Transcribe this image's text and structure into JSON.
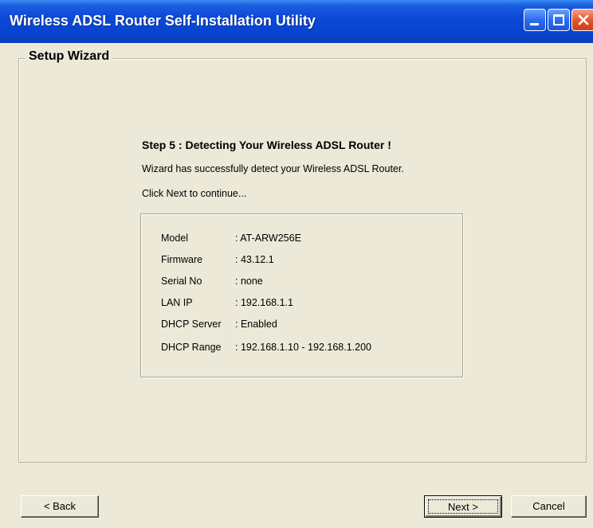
{
  "window": {
    "title": "Wireless ADSL Router Self-Installation Utility",
    "controls": [
      "minimize",
      "maximize",
      "close"
    ]
  },
  "wizard": {
    "group_title": "Setup Wizard",
    "step_title": "Step 5 : Detecting Your Wireless ADSL Router !",
    "message": "Wizard has successfully detect your Wireless ADSL Router.",
    "instruction": "Click Next to continue..."
  },
  "router_info": [
    {
      "label": "Model",
      "value": ": AT-ARW256E"
    },
    {
      "label": "Firmware",
      "value": ": 43.12.1"
    },
    {
      "label": "Serial No",
      "value": ": none"
    },
    {
      "label": "LAN IP",
      "value": ": 192.168.1.1"
    },
    {
      "label": "DHCP Server",
      "value": ": Enabled"
    },
    {
      "label": "DHCP Range",
      "value": ": 192.168.1.10 - 192.168.1.200"
    }
  ],
  "buttons": {
    "back": "< Back",
    "next": "Next >",
    "cancel": "Cancel"
  }
}
